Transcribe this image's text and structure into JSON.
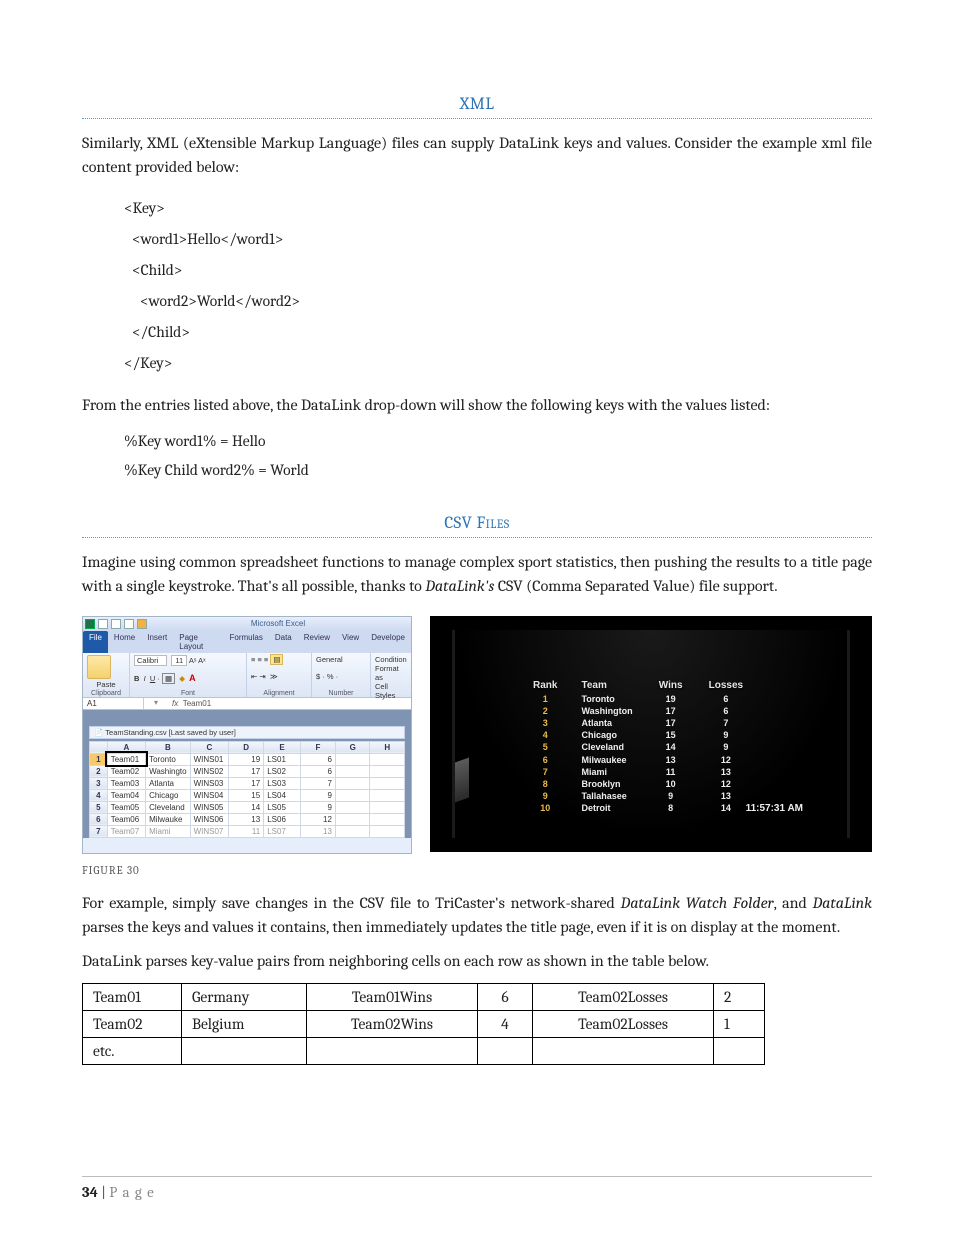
{
  "sections": {
    "xml_heading": "XML",
    "csv_heading": "CSV Files"
  },
  "paragraphs": {
    "xml_intro": "Similarly, XML (eXtensible Markup Language) files can supply DataLink keys and values.  Consider the example xml file content provided below:",
    "xml_keys_intro": "From the entries listed above, the DataLink drop-down will show the following keys with the values listed:",
    "csv_intro_pre": "Imagine using common spreadsheet functions to manage complex sport statistics, then pushing the results to a title page with a single keystroke.  That's all possible, thanks to ",
    "csv_intro_em": "DataLink's",
    "csv_intro_post": " CSV (Comma Separated Value) file support.",
    "csv_after1_pre": "For example, simply save changes in the CSV file to TriCaster's network-shared ",
    "csv_after1_em": "DataLink Watch Folder",
    "csv_after1_mid": ", and ",
    "csv_after1_em2": "DataLink",
    "csv_after1_post": " parses the keys and values it contains, then immediately updates the title page, even if it is on display at the moment.",
    "csv_after2": "DataLink parses key-value pairs from neighboring cells on each row as shown in the table below."
  },
  "xml_code": {
    "l1": "<Key>",
    "l2": "<word1>Hello</word1>",
    "l3": "<Child>",
    "l4": "<word2>World</word2>",
    "l5": "</Child>",
    "l6": "</Key>"
  },
  "xml_keys": {
    "k1": "%Key word1% = Hello",
    "k2": "%Key Child word2% = World"
  },
  "figure": {
    "caption": "FIGURE 30"
  },
  "excel": {
    "app_title": "Microsoft Excel",
    "tabs": [
      "File",
      "Home",
      "Insert",
      "Page Layout",
      "Formulas",
      "Data",
      "Review",
      "View",
      "Develope"
    ],
    "group_clipboard": "Clipboard",
    "paste_label": "Paste",
    "font_name": "Calibri",
    "font_size": "11",
    "group_font": "Font",
    "group_align": "Alignment",
    "num_general": "General",
    "group_number": "Number",
    "cond_fmt": "Condition",
    "fmt_as": "Format as",
    "cell_styles": "Cell Styles",
    "name_box": "A1",
    "fx_label": "fx",
    "fx_value": "Team01",
    "filebar": "TeamStanding.csv [Last saved by user]",
    "cols": [
      "A",
      "B",
      "C",
      "D",
      "E",
      "F",
      "G",
      "H"
    ],
    "rows": [
      {
        "n": "1",
        "a": "Team01",
        "b": "Toronto",
        "c": "WINS01",
        "d": "",
        "e": "19",
        "e2": "LS01",
        "f": "6"
      },
      {
        "n": "2",
        "a": "Team02",
        "b": "Washingto",
        "c": "WINS02",
        "d": "",
        "e": "17",
        "e2": "LS02",
        "f": "6"
      },
      {
        "n": "3",
        "a": "Team03",
        "b": "Atlanta",
        "c": "WINS03",
        "d": "",
        "e": "17",
        "e2": "LS03",
        "f": "7"
      },
      {
        "n": "4",
        "a": "Team04",
        "b": "Chicago",
        "c": "WINS04",
        "d": "",
        "e": "15",
        "e2": "LS04",
        "f": "9"
      },
      {
        "n": "5",
        "a": "Team05",
        "b": "Cleveland",
        "c": "WINS05",
        "d": "",
        "e": "14",
        "e2": "LS05",
        "f": "9"
      },
      {
        "n": "6",
        "a": "Team06",
        "b": "Milwauke",
        "c": "WINS06",
        "d": "",
        "e": "13",
        "e2": "LS06",
        "f": "12"
      },
      {
        "n": "7",
        "a": "Team07",
        "b": "Miami",
        "c": "WINS07",
        "d": "",
        "e": "11",
        "e2": "LS07",
        "f": "13"
      }
    ]
  },
  "tricaster": {
    "headers": {
      "rank": "Rank",
      "team": "Team",
      "wins": "Wins",
      "losses": "Losses"
    },
    "rows": [
      {
        "rank": "1",
        "team": "Toronto",
        "wins": "19",
        "losses": "6"
      },
      {
        "rank": "2",
        "team": "Washington",
        "wins": "17",
        "losses": "6"
      },
      {
        "rank": "3",
        "team": "Atlanta",
        "wins": "17",
        "losses": "7"
      },
      {
        "rank": "4",
        "team": "Chicago",
        "wins": "15",
        "losses": "9"
      },
      {
        "rank": "5",
        "team": "Cleveland",
        "wins": "14",
        "losses": "9"
      },
      {
        "rank": "6",
        "team": "Milwaukee",
        "wins": "13",
        "losses": "12"
      },
      {
        "rank": "7",
        "team": "Miami",
        "wins": "11",
        "losses": "13"
      },
      {
        "rank": "8",
        "team": "Brooklyn",
        "wins": "10",
        "losses": "12"
      },
      {
        "rank": "9",
        "team": "Tallahasee",
        "wins": "9",
        "losses": "13"
      },
      {
        "rank": "10",
        "team": "Detroit",
        "wins": "8",
        "losses": "14"
      }
    ],
    "clock": "11:57:31 AM"
  },
  "kv_table": {
    "rows": [
      {
        "c1": "Team01",
        "c2": "Germany",
        "c3": "Team01Wins",
        "c4": "6",
        "c5": "Team02Losses",
        "c6": "2"
      },
      {
        "c1": "Team02",
        "c2": "Belgium",
        "c3": "Team02Wins",
        "c4": "4",
        "c5": "Team02Losses",
        "c6": "1"
      },
      {
        "c1": "etc.",
        "c2": "",
        "c3": "",
        "c4": "",
        "c5": "",
        "c6": ""
      }
    ]
  },
  "footer": {
    "page_number": "34",
    "sep": " | ",
    "label": "P a g e"
  }
}
